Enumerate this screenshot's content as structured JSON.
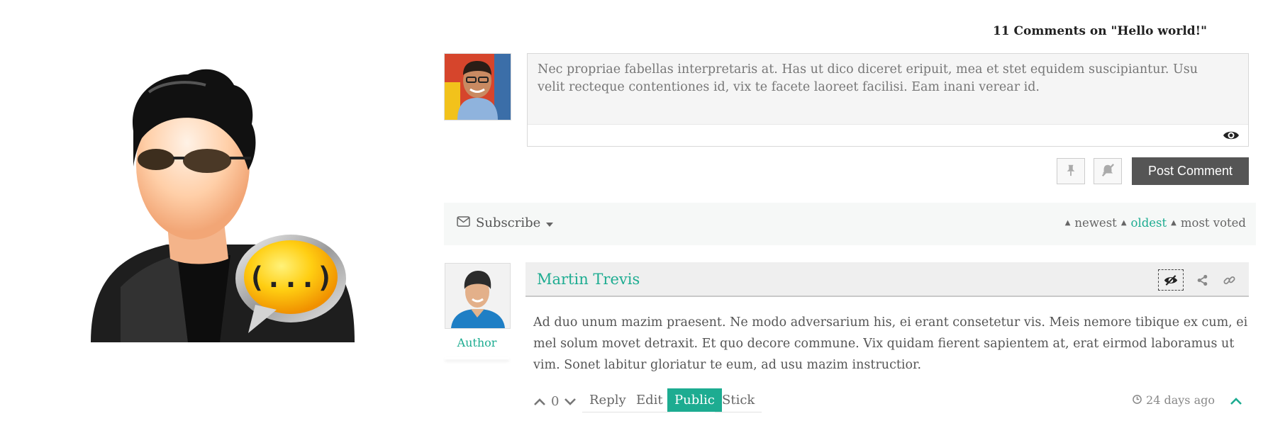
{
  "comments_header": "11 Comments on \"Hello world!\"",
  "editor": {
    "text": "Nec propriae fabellas interpretaris at. Has ut dico diceret eripuit, mea et stet equidem suscipiantur. Usu velit recteque contentiones id, vix te facete laoreet facilisi. Eam inani verear id.",
    "post_button": "Post Comment"
  },
  "toolbar": {
    "subscribe": "Subscribe",
    "sort_newest": "newest",
    "sort_oldest": "oldest",
    "sort_most_voted": "most voted",
    "active_sort": "oldest"
  },
  "comment": {
    "author": "Martin Trevis",
    "role": "Author",
    "body": "Ad duo unum mazim praesent. Ne modo adversarium his, ei erant consetetur vis. Meis nemore tibique ex cum, ei mel solum movet detraxit. Et quo decore commune. Vix quidam fierent sapientem at, erat eirmod laboramus ut vim. Sonet labitur gloriatur te eum, ad usu mazim instructior.",
    "votes": "0",
    "actions": {
      "reply": "Reply",
      "edit": "Edit",
      "public": "Public",
      "stick": "Stick"
    },
    "time": "24 days ago"
  },
  "colors": {
    "accent": "#1dac91",
    "button_dark": "#555555",
    "toolbar_bg": "#f6f8f7"
  },
  "icons": [
    "user-chat-avatar-icon",
    "eye-icon",
    "pin-icon",
    "mute-icon",
    "envelope-icon",
    "caret-down-icon",
    "hide-eye-icon",
    "share-icon",
    "link-icon",
    "vote-up-icon",
    "vote-down-icon",
    "clock-icon",
    "chevron-up-icon"
  ]
}
